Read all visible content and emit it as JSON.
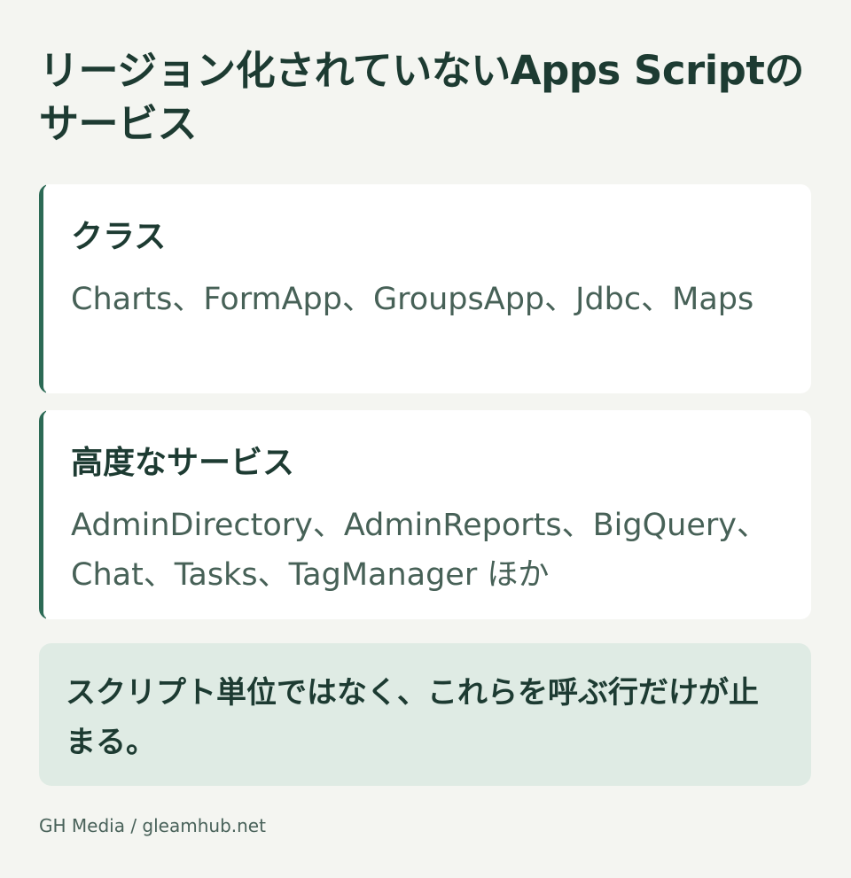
{
  "title": "リージョン化されていないApps Scriptのサービス",
  "cards": [
    {
      "heading": "クラス",
      "body": "Charts、FormApp、GroupsApp、Jdbc、Maps"
    },
    {
      "heading": "高度なサービス",
      "body": "AdminDirectory、AdminReports、BigQuery、Chat、Tasks、TagManager ほか"
    }
  ],
  "note": "スクリプト単位ではなく、これらを呼ぶ行だけが止まる。",
  "footer": "GH Media / gleamhub.net",
  "colors": {
    "background": "#f4f5f1",
    "card": "#ffffff",
    "accent": "#2c6a55",
    "note_background": "#dfebe4",
    "title_text": "#1d3b32",
    "body_text": "#476157"
  }
}
